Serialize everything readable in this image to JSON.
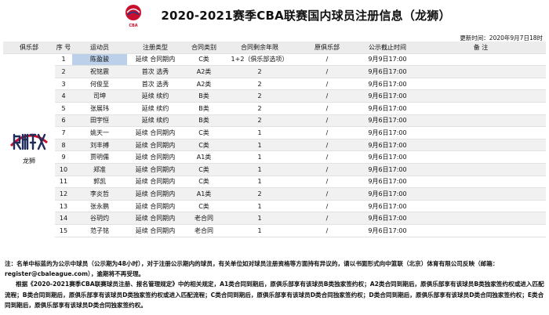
{
  "document": {
    "title": "2020-2021赛季CBA联赛国内球员注册信息（龙狮）",
    "update_time": "更新时间：2020年9月7日18时"
  },
  "table": {
    "headers": [
      "俱乐部",
      "序 号",
      "运动员",
      "注册类型",
      "合同类别",
      "合同剩余年限",
      "原俱乐部",
      "公示截止时间",
      "备 注"
    ],
    "club": "龙狮",
    "rows": [
      {
        "no": "1",
        "name": "陈盈骏",
        "type": "延续  合同期内",
        "category": "C类",
        "years": "1+2（俱乐部选项）",
        "orig": "/",
        "deadline": "9月9日17:00",
        "note": ""
      },
      {
        "no": "2",
        "name": "祝铭震",
        "type": "首次    选秀",
        "category": "A2类",
        "years": "2",
        "orig": "/",
        "deadline": "9月6日17:00",
        "note": ""
      },
      {
        "no": "3",
        "name": "何俊至",
        "type": "首次    选秀",
        "category": "A2类",
        "years": "2",
        "orig": "/",
        "deadline": "9月6日17:00",
        "note": ""
      },
      {
        "no": "4",
        "name": "司坤",
        "type": "延续    续约",
        "category": "B类",
        "years": "2",
        "orig": "/",
        "deadline": "9月6日17:00",
        "note": ""
      },
      {
        "no": "5",
        "name": "张展玮",
        "type": "延续    续约",
        "category": "B类",
        "years": "2",
        "orig": "/",
        "deadline": "9月6日17:00",
        "note": ""
      },
      {
        "no": "6",
        "name": "田宇恒",
        "type": "延续    续约",
        "category": "B类",
        "years": "2",
        "orig": "/",
        "deadline": "9月6日17:00",
        "note": ""
      },
      {
        "no": "7",
        "name": "姚天一",
        "type": "延续  合同期内",
        "category": "C类",
        "years": "1",
        "orig": "/",
        "deadline": "9月6日17:00",
        "note": ""
      },
      {
        "no": "8",
        "name": "刘丰搏",
        "type": "延续  合同期内",
        "category": "C类",
        "years": "1",
        "orig": "/",
        "deadline": "9月6日17:00",
        "note": ""
      },
      {
        "no": "9",
        "name": "贾明儒",
        "type": "延续  合同期内",
        "category": "A1类",
        "years": "1",
        "orig": "/",
        "deadline": "9月6日17:00",
        "note": ""
      },
      {
        "no": "10",
        "name": "郑准",
        "type": "延续  合同期内",
        "category": "C类",
        "years": "1",
        "orig": "/",
        "deadline": "9月6日17:00",
        "note": ""
      },
      {
        "no": "11",
        "name": "郭凯",
        "type": "延续  合同期内",
        "category": "C类",
        "years": "1",
        "orig": "/",
        "deadline": "9月6日17:00",
        "note": ""
      },
      {
        "no": "12",
        "name": "李炎哲",
        "type": "延续  合同期内",
        "category": "A1类",
        "years": "2",
        "orig": "/",
        "deadline": "9月6日17:00",
        "note": ""
      },
      {
        "no": "13",
        "name": "张永鹏",
        "type": "延续  合同期内",
        "category": "C类",
        "years": "1",
        "orig": "/",
        "deadline": "9月6日17:00",
        "note": ""
      },
      {
        "no": "14",
        "name": "谷玥灼",
        "type": "延续  合同期内",
        "category": "老合同",
        "years": "1",
        "orig": "/",
        "deadline": "9月6日17:00",
        "note": ""
      },
      {
        "no": "15",
        "name": "范子铭",
        "type": "延续  合同期内",
        "category": "老合同",
        "years": "1",
        "orig": "/",
        "deadline": "9月6日17:00",
        "note": ""
      }
    ]
  },
  "notes": {
    "note1": "注：名单中标蓝的为公示中球员（公示期为48小时），对于注册公示期内的球员，有关单位如对球员注册资格等方面持有异议的，请以书面形式向中篮联（北京）体育有限公司反映（邮箱：register@cbaleague.com），逾期将不再受理。",
    "note2": "根据《2020-2021赛季CBA联赛球员注册、报名管理规定》中的相关规定，A1类合同到期后，原俱乐部享有该球员B类独家签约权；A2类合同到期后，原俱乐部享有该球员B类独家签约权或进入匹配流程；B类合同到期后，原俱乐部享有该球员D类独家签约权或进入匹配流程；C类合同到期后，原俱乐部享有该球员D类合同独家签约权；D类合同到期后，原俱乐部享有该球员D类合同独家签约权；E类合同到期后，原俱乐部享有该球员D类合同独家签约权。"
  },
  "colors": {
    "selected_row_highlight": "#bcd0ea",
    "header_background": "#ececec",
    "logo_red": "#c8102e"
  }
}
